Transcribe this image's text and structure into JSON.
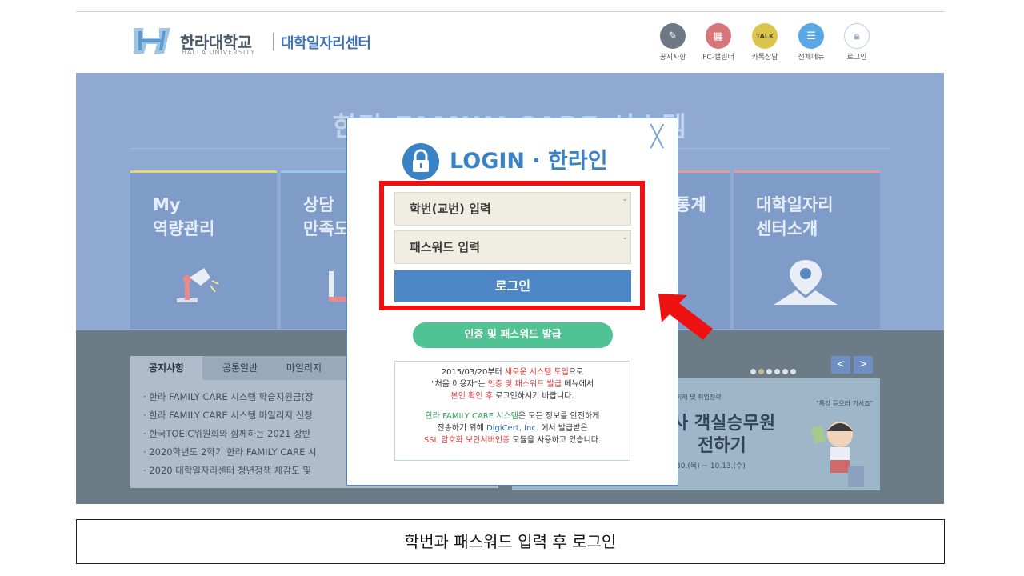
{
  "header": {
    "logo_text": "한라대학교",
    "logo_sub": "HALLA UNIVERSITY",
    "center_name": "대학일자리센터",
    "icons": [
      {
        "name": "notice-icon",
        "label": "공지사항",
        "color": "#6d7884"
      },
      {
        "name": "calendar-icon",
        "label": "FC-캘린더",
        "color": "#d7767a"
      },
      {
        "name": "talk-icon",
        "label": "카톡상담",
        "color": "#dac64a"
      },
      {
        "name": "menu-icon",
        "label": "전체메뉴",
        "color": "#5aa7e6"
      },
      {
        "name": "lock-icon",
        "label": "로그인",
        "color": "#c3cfdd"
      }
    ]
  },
  "hero": {
    "title": "한라 FAMILY CARE 시스템",
    "cards": [
      {
        "title": "My\n역량관리",
        "accent": "#e7d774"
      },
      {
        "title": "상담\n만족도",
        "accent": "#9cc6ee"
      },
      {
        "title": "통계",
        "accent": "#e79a9a"
      },
      {
        "title": "대학일자리\n센터소개",
        "accent": "#e79a9a"
      }
    ]
  },
  "notices": {
    "tabs": [
      "공지사항",
      "공통일반",
      "마일리지"
    ],
    "items": [
      "· 한라 FAMILY CARE 시스템 학습지원금(장",
      "· 한라 FAMILY CARE 시스템 마일리지 신청",
      "· 한국TOEIC위원회와 함께하는 2021 상반",
      "· 2020학년도 2학기 한라 FAMILY CARE 시",
      "· 2020 대학일자리센터 청년정책 체감도 및"
    ]
  },
  "banner": {
    "small": "이해 및 취업전략",
    "line1": "사 객실승무원",
    "line2": "전하기",
    "dates": "30.(목) ~ 10.13.(수)",
    "note": "\"특강 듣으러 가시죠\""
  },
  "modal": {
    "title": "LOGIN · 한라인",
    "id_placeholder": "학번(교번) 입력",
    "pw_placeholder": "패스워드 입력",
    "login_label": "로그인",
    "cert_label": "인증 및 패스워드 발급",
    "info": {
      "l1a": "2015/03/20부터 ",
      "l1b": "새로운 시스템 도입",
      "l1c": "으로",
      "l2a": "\"처음 이용자\"는 ",
      "l2b": "인증 및 패스워드 발급",
      "l2c": " 메뉴에서",
      "l3a": "본인 확인 후",
      "l3b": " 로그인하시기 바랍니다.",
      "l4a": "한라 FAMILY CARE 시스템",
      "l4b": "은 모든 정보를 안전하게",
      "l5a": "전송하기 위해 ",
      "l5b": "DigiCert, Inc.",
      "l5c": " 에서 발급받은",
      "l6a": "SSL 암호화 보안서버인증",
      "l6b": " 모듈을 사용하고 있습니다."
    }
  },
  "caption": "학번과 패스워드 입력 후 로그인",
  "colors": {
    "highlight": "#ee1111",
    "accent": "#3a82c6",
    "green": "#50c394"
  }
}
